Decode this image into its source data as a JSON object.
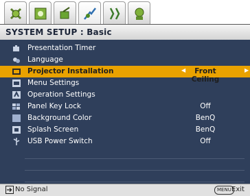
{
  "tabs": [
    {
      "icon": "picture-tab-icon"
    },
    {
      "icon": "picture-advanced-tab-icon"
    },
    {
      "icon": "display-tab-icon"
    },
    {
      "icon": "system-setup-basic-tab-icon",
      "active": true
    },
    {
      "icon": "system-setup-advanced-tab-icon"
    },
    {
      "icon": "information-tab-icon"
    }
  ],
  "header": {
    "title": "SYSTEM SETUP : Basic"
  },
  "menu": {
    "items": [
      {
        "label": "Presentation Timer",
        "value": "",
        "icon": "timer-icon"
      },
      {
        "label": "Language",
        "value": "",
        "icon": "language-icon"
      },
      {
        "label": "Projector Installation",
        "value": "Front Ceiling",
        "icon": "projector-icon",
        "selected": true
      },
      {
        "label": "Menu Settings",
        "value": "",
        "icon": "menu-settings-icon"
      },
      {
        "label": "Operation Settings",
        "value": "",
        "icon": "operation-settings-icon"
      },
      {
        "label": "Panel Key Lock",
        "value": "Off",
        "icon": "lock-icon"
      },
      {
        "label": "Background Color",
        "value": "BenQ",
        "icon": "background-color-icon"
      },
      {
        "label": "Splash Screen",
        "value": "BenQ",
        "icon": "splash-screen-icon"
      },
      {
        "label": "USB Power Switch",
        "value": "Off",
        "icon": "usb-icon"
      }
    ]
  },
  "status": {
    "signal": "No Signal",
    "menu_badge": "MENU",
    "exit": "Exit"
  },
  "colors": {
    "panel": "#2f3f5b",
    "highlight": "#e9a200",
    "title_bar": "#d4d4d4"
  }
}
